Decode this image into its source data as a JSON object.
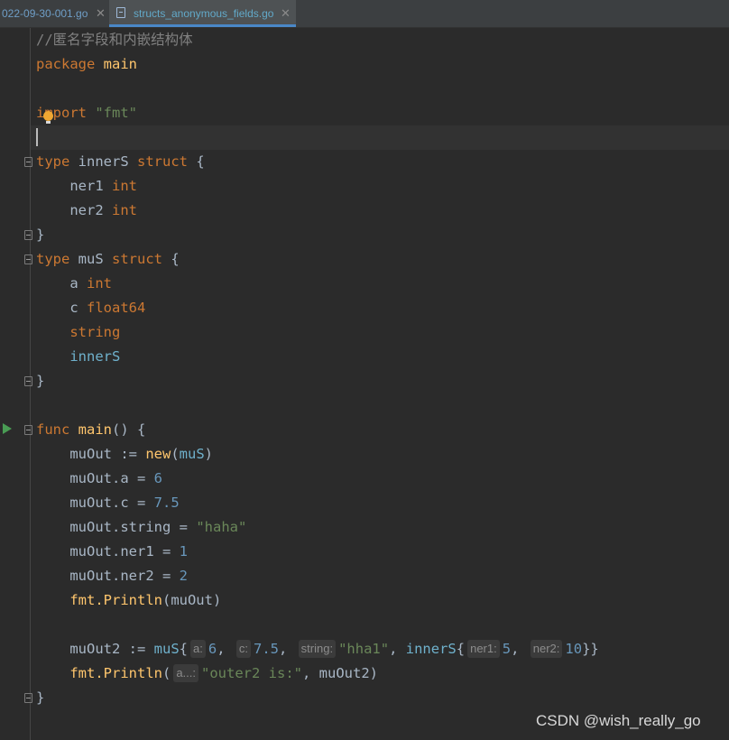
{
  "tabs": [
    {
      "label": "022-09-30-001.go",
      "close": "✕",
      "active": false
    },
    {
      "label": "structs_anonymous_fields.go",
      "close": "✕",
      "active": true
    }
  ],
  "code": {
    "comment": "//匿名字段和内嵌结构体",
    "pkg": {
      "kw": "package",
      "name": "main"
    },
    "imp": {
      "kw": "import",
      "path": "\"fmt\""
    },
    "innerS": {
      "kw": "type",
      "name": "innerS",
      "kw2": "struct",
      "open": "{",
      "f1": {
        "name": "ner1",
        "type": "int"
      },
      "f2": {
        "name": "ner2",
        "type": "int"
      },
      "close": "}"
    },
    "muS": {
      "kw": "type",
      "name": "muS",
      "kw2": "struct",
      "open": "{",
      "f1": {
        "name": "a",
        "type": "int"
      },
      "f2": {
        "name": "c",
        "type": "float64"
      },
      "f3": "string",
      "f4": "innerS",
      "close": "}"
    },
    "main": {
      "kw": "func",
      "name": "main",
      "sig": "() {",
      "l1": {
        "var": "muOut :=",
        "fn": "new",
        "open": "(",
        "arg": "muS",
        "close": ")"
      },
      "l2": {
        "lhs": "muOut.a =",
        "val": "6"
      },
      "l3": {
        "lhs": "muOut.c =",
        "val": "7.5"
      },
      "l4": {
        "lhs": "muOut.string =",
        "val": "\"haha\""
      },
      "l5": {
        "lhs": "muOut.ner1 =",
        "val": "1"
      },
      "l6": {
        "lhs": "muOut.ner2 =",
        "val": "2"
      },
      "l7": {
        "pkg": "fmt.",
        "fn": "Println",
        "args": "(muOut)"
      },
      "l8": {
        "var": "muOut2 :=",
        "type": "muS",
        "open": "{",
        "h_a": "a:",
        "v_a": "6",
        "h_c": "c:",
        "v_c": "7.5",
        "h_s": "string:",
        "v_s": "\"hha1\"",
        "inner": "innerS",
        "inner_open": "{",
        "h_n1": "ner1:",
        "v_n1": "5",
        "h_n2": "ner2:",
        "v_n2": "10",
        "close": "}}"
      },
      "l9": {
        "pkg": "fmt.",
        "fn": "Println",
        "open": "(",
        "hint": "a...:",
        "str": "\"outer2 is:\"",
        "rest": ", muOut2)"
      },
      "close": "}"
    }
  },
  "watermark": "CSDN @wish_really_go",
  "colors": {
    "background": "#2b2b2b",
    "keyword": "#cc7832",
    "function": "#ffc66d",
    "string": "#6a8759",
    "number": "#6897bb",
    "type": "#6fb1cc",
    "comment": "#808080"
  }
}
